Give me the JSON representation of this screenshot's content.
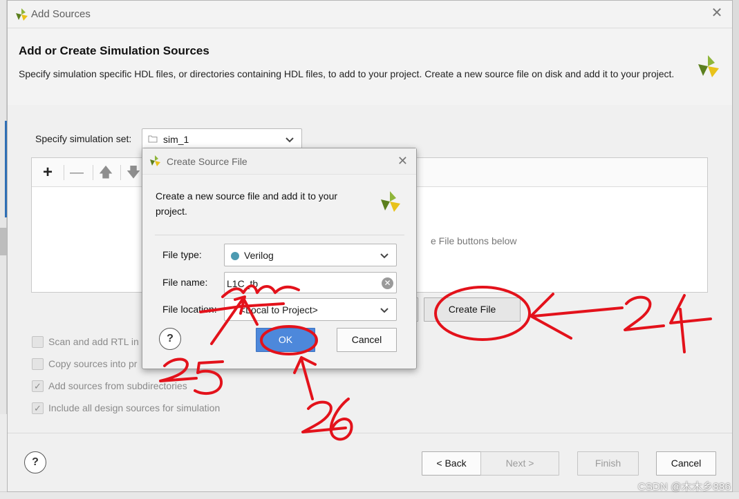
{
  "background": {
    "accent_color": "#2f6fb5"
  },
  "dialog": {
    "title": "Add Sources",
    "close_icon": "close-icon",
    "heading": "Add or Create Simulation Sources",
    "description": "Specify simulation specific HDL files, or directories containing HDL files, to add to your project. Create a new source file on disk and add it to your project.",
    "simset_label": "Specify simulation set:",
    "simset_value": "sim_1",
    "files_toolbar": [
      "plus-icon",
      "minus-icon",
      "arrow-up-icon",
      "arrow-down-icon"
    ],
    "files_empty_hint": "e File buttons below",
    "create_file_button": "Create File",
    "options": [
      {
        "label": "Scan and add RTL in",
        "checked": false
      },
      {
        "label": "Copy sources into pr",
        "checked": false
      },
      {
        "label": "Add sources from subdirectories",
        "checked": true
      },
      {
        "label": "Include all design sources for simulation",
        "checked": true
      }
    ],
    "footer": {
      "help": "?",
      "back": "< Back",
      "next": "Next >",
      "finish": "Finish",
      "cancel": "Cancel"
    }
  },
  "create_source_dialog": {
    "title": "Create Source File",
    "description": "Create a new source file and add it to your project.",
    "file_type_label": "File type:",
    "file_type_value": "Verilog",
    "file_type_color": "#4c9ab1",
    "file_name_label": "File name:",
    "file_name_value": "L1C_tb",
    "file_location_label": "File location:",
    "file_location_value": "<Local to Project>",
    "help": "?",
    "ok": "OK",
    "cancel": "Cancel",
    "ok_color": "#4d88db"
  },
  "annotations": {
    "color": "#e3121b",
    "labels": [
      "24",
      "25",
      "26"
    ]
  },
  "watermark": "CSDN @木木乡886"
}
